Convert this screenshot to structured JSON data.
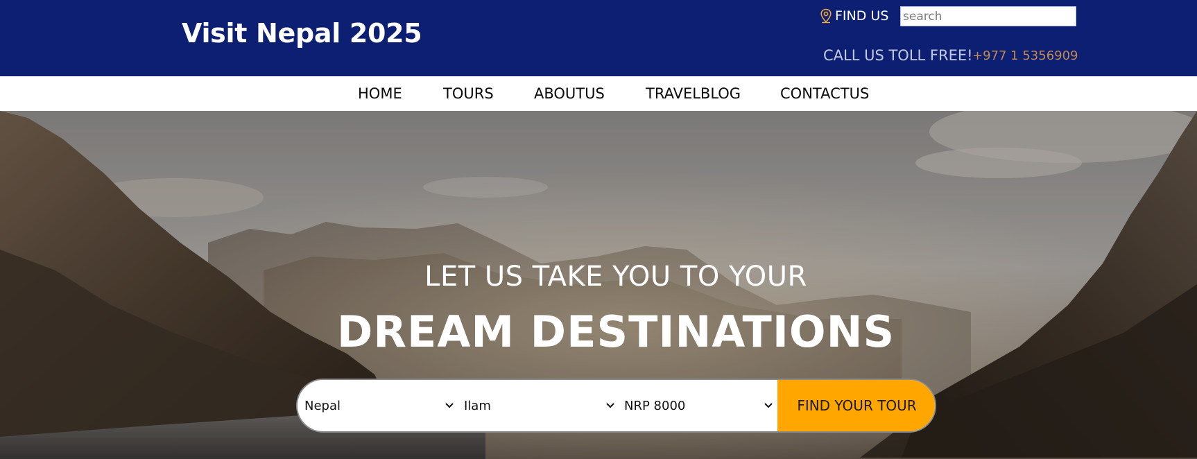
{
  "header": {
    "site_title": "Visit Nepal 2025",
    "find_us": {
      "label": "FIND US",
      "icon": "map-pin-icon"
    },
    "search": {
      "placeholder": "search",
      "value": ""
    },
    "toll_free_label": "CALL US TOLL FREE!",
    "phone": "+977 1 5356909"
  },
  "nav": {
    "items": [
      {
        "label": "HOME"
      },
      {
        "label": "TOURS"
      },
      {
        "label": "ABOUTUS"
      },
      {
        "label": "TRAVELBLOG"
      },
      {
        "label": "CONTACTUS"
      }
    ]
  },
  "hero": {
    "subtitle": "LET US TAKE YOU TO YOUR",
    "title": "DREAM DESTINATIONS"
  },
  "tour_search": {
    "country": {
      "value": "Nepal"
    },
    "city": {
      "value": "Ilam"
    },
    "budget": {
      "value": "NRP 8000"
    },
    "button_label": "FIND YOUR TOUR"
  },
  "colors": {
    "header_bg": "#0c1f72",
    "accent": "#ffa600",
    "phone": "#c38a52",
    "nav_bg": "#ffffff"
  }
}
